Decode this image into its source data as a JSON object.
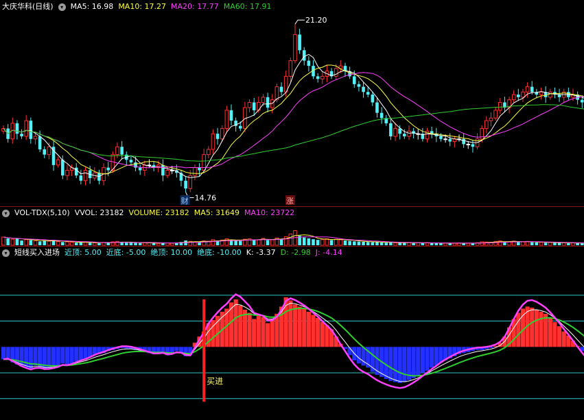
{
  "colors": {
    "up": "#ff3030",
    "down": "#54f0f8",
    "flat": "#ffffff",
    "ma5": "#ffffff",
    "ma10": "#ffff40",
    "ma20": "#ff40ff",
    "ma60": "#30d030",
    "buy_marker": "#ffff66",
    "sep": "#8a1010",
    "guide": "#30c8c8"
  },
  "panel1": {
    "title": "大庆华科(日线)",
    "ma5_label": "MA5: 16.98",
    "ma10_label": "MA10: 17.27",
    "ma20_label": "MA20: 17.77",
    "ma60_label": "MA60: 17.91",
    "high_label": "21.20",
    "low_label": "14.76",
    "event_cai": "财",
    "event_zhang": "涨"
  },
  "panel2": {
    "title": "VOL-TDX(5,10)",
    "vvol_label": "VVOL: 23182",
    "volume_label": "VOLUME: 23182",
    "ma5_label": "MA5: 31649",
    "ma10_label": "MA10: 23722"
  },
  "panel3": {
    "title": "短线买入进场",
    "near_top": "近顶: 5.00",
    "near_bottom": "近底: -5.00",
    "abs_top": "绝顶: 10.00",
    "abs_bottom": "绝底: -10.00",
    "k_label": "K: -3.37",
    "d_label": "D: -2.98",
    "j_label": "J: -4.14",
    "buy_signal": "买进"
  },
  "chart_data": [
    {
      "type": "candlestick",
      "name": "大庆华科(日线)",
      "ylim": [
        14.3,
        21.6
      ],
      "high": 21.2,
      "low": 14.76,
      "open": [
        17.1,
        17.2,
        16.8,
        17.4,
        17.0,
        16.9,
        17.5,
        16.8,
        16.9,
        16.4,
        16.2,
        16.5,
        15.8,
        16.0,
        15.4,
        15.6,
        15.7,
        15.4,
        15.2,
        15.6,
        15.3,
        15.5,
        15.2,
        15.7,
        15.6,
        16.2,
        16.5,
        16.2,
        16.0,
        15.9,
        15.7,
        15.6,
        15.8,
        15.8,
        15.7,
        15.8,
        15.4,
        15.6,
        15.6,
        15.5,
        15.2,
        14.9,
        15.4,
        15.7,
        15.6,
        16.2,
        16.4,
        17.0,
        16.8,
        17.2,
        17.9,
        17.5,
        17.3,
        17.2,
        18.0,
        18.2,
        17.9,
        18.2,
        18.4,
        18.0,
        18.3,
        18.8,
        18.6,
        19.2,
        19.8,
        20.8,
        20.2,
        19.8,
        19.6,
        19.2,
        19.1,
        19.2,
        19.4,
        19.2,
        19.5,
        19.6,
        19.4,
        19.2,
        18.9,
        18.8,
        18.6,
        18.5,
        18.2,
        17.8,
        17.6,
        17.4,
        16.9,
        17.2,
        17.0,
        16.9,
        17.1,
        17.0,
        17.0,
        16.8,
        17.1,
        17.0,
        16.9,
        16.8,
        16.8,
        16.7,
        16.8,
        16.8,
        16.6,
        16.6,
        16.5,
        16.8,
        17.2,
        17.5,
        17.6,
        17.9,
        18.2,
        18.0,
        18.3,
        18.5,
        18.4,
        18.6,
        18.8,
        18.6,
        18.5,
        18.6,
        18.4,
        18.6,
        18.5,
        18.4,
        18.6,
        18.4,
        18.5,
        18.3,
        18.2
      ],
      "close": [
        17.2,
        16.8,
        17.4,
        17.0,
        16.9,
        17.5,
        16.8,
        16.9,
        16.4,
        16.2,
        16.5,
        15.8,
        16.0,
        15.4,
        15.6,
        15.7,
        15.4,
        15.2,
        15.6,
        15.3,
        15.5,
        15.2,
        15.7,
        15.6,
        16.2,
        16.5,
        16.2,
        16.0,
        15.9,
        15.7,
        15.6,
        15.8,
        15.8,
        15.7,
        15.8,
        15.4,
        15.6,
        15.6,
        15.5,
        15.2,
        14.9,
        15.4,
        15.7,
        15.6,
        16.2,
        16.4,
        17.0,
        16.8,
        17.2,
        17.9,
        17.5,
        17.3,
        17.2,
        18.0,
        18.2,
        17.9,
        18.2,
        18.4,
        18.0,
        18.3,
        18.8,
        18.6,
        19.2,
        19.8,
        20.8,
        20.2,
        19.8,
        19.6,
        19.2,
        19.1,
        19.2,
        19.4,
        19.2,
        19.5,
        19.6,
        19.4,
        19.2,
        18.9,
        18.8,
        18.6,
        18.5,
        18.2,
        17.8,
        17.6,
        17.4,
        16.9,
        17.2,
        17.0,
        16.9,
        17.1,
        17.0,
        17.0,
        16.8,
        17.1,
        17.0,
        16.9,
        16.8,
        16.8,
        16.7,
        16.8,
        16.8,
        16.6,
        16.6,
        16.5,
        16.8,
        17.2,
        17.5,
        17.6,
        17.9,
        18.2,
        18.0,
        18.3,
        18.5,
        18.4,
        18.6,
        18.8,
        18.6,
        18.5,
        18.6,
        18.4,
        18.6,
        18.5,
        18.4,
        18.6,
        18.4,
        18.5,
        18.3,
        18.2,
        18.1
      ]
    },
    {
      "type": "bar",
      "name": "VOL-TDX(5,10)",
      "ylim": [
        0,
        120000
      ],
      "values": [
        38000,
        32000,
        28000,
        30000,
        22000,
        26000,
        24000,
        20000,
        18000,
        21000,
        19000,
        25000,
        17000,
        15000,
        16000,
        14000,
        12000,
        13000,
        15000,
        12000,
        11000,
        10000,
        13000,
        12000,
        16000,
        18000,
        14000,
        12000,
        13000,
        11000,
        10000,
        12000,
        11000,
        10000,
        9000,
        12000,
        11000,
        10000,
        13000,
        15000,
        22000,
        18000,
        16000,
        14000,
        20000,
        19000,
        26000,
        22000,
        24000,
        30000,
        25000,
        21000,
        20000,
        28000,
        30000,
        24000,
        26000,
        32000,
        24000,
        27000,
        34000,
        30000,
        40000,
        52000,
        68000,
        44000,
        36000,
        32000,
        28000,
        25000,
        26000,
        30000,
        24000,
        28000,
        26000,
        22000,
        20000,
        18000,
        17000,
        16000,
        15000,
        14000,
        16000,
        13000,
        12000,
        14000,
        11000,
        12000,
        11000,
        13000,
        10000,
        11000,
        10000,
        12000,
        10000,
        11000,
        9000,
        10000,
        9000,
        10000,
        11000,
        9000,
        10000,
        9000,
        12000,
        16000,
        15000,
        14000,
        18000,
        20000,
        16000,
        17000,
        19000,
        15000,
        16000,
        18000,
        14000,
        13000,
        14000,
        12000,
        13000,
        12000,
        11000,
        12000,
        10000,
        11000,
        10000,
        9000,
        10000
      ]
    },
    {
      "type": "bar",
      "name": "短线买入进场",
      "ylim": [
        -14,
        17
      ],
      "guides": [
        10,
        5,
        -5,
        -10
      ],
      "values": [
        -2.4,
        -2.2,
        -3.0,
        -3.4,
        -3.8,
        -4.0,
        -4.2,
        -3.6,
        -3.8,
        -4.2,
        -4.0,
        -3.8,
        -3.6,
        -3.2,
        -3.6,
        -3.2,
        -2.8,
        -2.6,
        -2.4,
        -2.0,
        -1.6,
        -1.4,
        -1.2,
        -0.8,
        -0.6,
        -0.4,
        -0.2,
        -0.3,
        -0.4,
        -0.6,
        -0.8,
        -1.0,
        -1.2,
        -1.4,
        -1.2,
        -1.0,
        -1.6,
        -1.2,
        -0.8,
        -1.2,
        -1.8,
        -1.6,
        0.8,
        2.0,
        3.0,
        4.6,
        5.2,
        6.0,
        6.8,
        7.4,
        8.6,
        9.2,
        8.0,
        7.2,
        6.6,
        5.4,
        6.0,
        5.8,
        4.6,
        5.4,
        6.4,
        7.8,
        9.6,
        9.0,
        8.2,
        7.8,
        7.4,
        6.8,
        6.2,
        5.6,
        4.8,
        4.2,
        3.4,
        2.0,
        0.6,
        -0.4,
        -1.6,
        -2.6,
        -3.2,
        -3.6,
        -4.0,
        -4.8,
        -5.4,
        -5.8,
        -6.2,
        -6.6,
        -6.8,
        -7.0,
        -6.8,
        -6.4,
        -6.0,
        -5.6,
        -5.0,
        -4.6,
        -4.0,
        -3.6,
        -3.0,
        -2.6,
        -2.2,
        -1.8,
        -1.4,
        -1.2,
        -1.0,
        -0.8,
        -0.6,
        -0.6,
        -0.4,
        -0.2,
        0.2,
        0.8,
        2.0,
        3.8,
        5.4,
        6.6,
        7.4,
        7.8,
        7.6,
        7.2,
        6.8,
        6.4,
        5.6,
        4.8,
        4.0,
        3.0,
        2.2,
        1.2,
        0.2,
        -0.8,
        -1.6
      ]
    }
  ]
}
